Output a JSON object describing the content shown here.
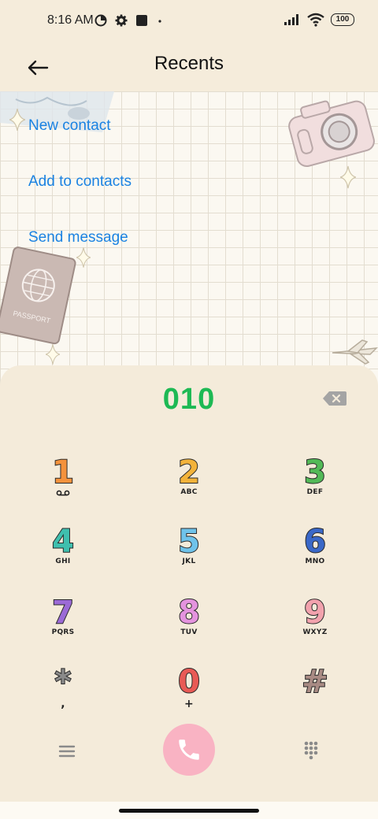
{
  "status_bar": {
    "time": "8:16 AM",
    "battery": "100",
    "icons": [
      "data-saver-icon",
      "settings-icon",
      "square-notification-icon",
      "dot-icon",
      "signal-icon",
      "wifi-icon",
      "battery-icon"
    ]
  },
  "header": {
    "title": "Recents",
    "back_icon": "back-arrow-icon"
  },
  "actions": [
    {
      "label": "New contact"
    },
    {
      "label": "Add to contacts"
    },
    {
      "label": "Send message"
    }
  ],
  "background_decor": [
    "camera",
    "passport",
    "map",
    "sparkles",
    "airplane"
  ],
  "decor_text": {
    "passport": "PASSPORT"
  },
  "dialer": {
    "number": "010",
    "keys": [
      {
        "digit": "1",
        "letters": "",
        "color": "#f4923c"
      },
      {
        "digit": "2",
        "letters": "ABC",
        "color": "#f3b33a"
      },
      {
        "digit": "3",
        "letters": "DEF",
        "color": "#52b957"
      },
      {
        "digit": "4",
        "letters": "GHI",
        "color": "#3fbfae"
      },
      {
        "digit": "5",
        "letters": "JKL",
        "color": "#6fc3ea"
      },
      {
        "digit": "6",
        "letters": "MNO",
        "color": "#3a68c8"
      },
      {
        "digit": "7",
        "letters": "PQRS",
        "color": "#9b6ad6"
      },
      {
        "digit": "8",
        "letters": "TUV",
        "color": "#e493de"
      },
      {
        "digit": "9",
        "letters": "WXYZ",
        "color": "#f2a2ad"
      },
      {
        "digit": "*",
        "letters": ",",
        "color": "#8a8a8a"
      },
      {
        "digit": "0",
        "letters": "+",
        "color": "#e85a55"
      },
      {
        "digit": "#",
        "letters": "",
        "color": "#a98b84"
      }
    ]
  },
  "colors": {
    "accent_link": "#1a82e2",
    "dialed_number": "#1db954",
    "call_button": "#f9b3c3",
    "background": "#f5ecdb"
  }
}
